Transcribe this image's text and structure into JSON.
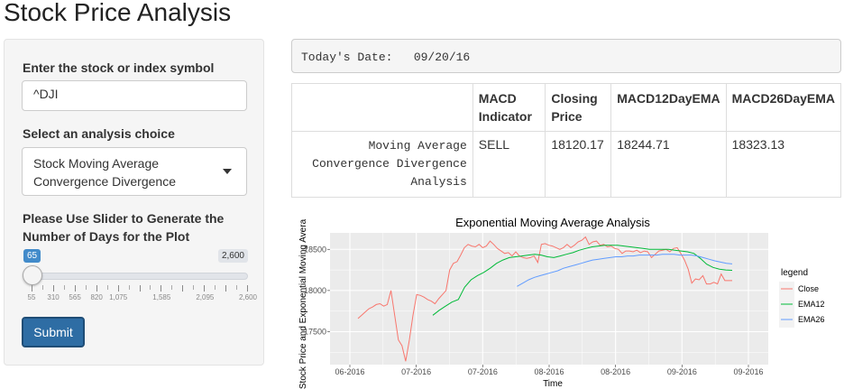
{
  "app": {
    "title": "Stock Price Analysis"
  },
  "sidebar": {
    "symbol_label": "Enter the stock or index symbol",
    "symbol_value": "^DJI",
    "analysis_label": "Select an analysis choice",
    "analysis_selected_line1": "Stock Moving Average",
    "analysis_selected_line2": "Convergence Divergence",
    "slider_label_line1": "Please Use Slider to Generate the",
    "slider_label_line2": "Number of Days for the Plot",
    "slider": {
      "min_badge": "65",
      "max_badge": "2,600",
      "value": 65,
      "min": 55,
      "max": 2600,
      "grid_labels": [
        "55",
        "310",
        "565",
        "820",
        "1,075",
        "1,585",
        "2,095",
        "2,600"
      ]
    },
    "submit_label": "Submit"
  },
  "main": {
    "date_label": "Today's Date:",
    "date_value": "09/20/16",
    "table": {
      "headers": [
        "",
        "MACD Indicator",
        "Closing Price",
        "MACD12DayEMA",
        "MACD26DayEMA"
      ],
      "row": {
        "name_line1": "Moving Average",
        "name_line2": "Convergence Divergence",
        "name_line3": "Analysis",
        "indicator": "SELL",
        "closing": "18120.17",
        "ema12": "18244.71",
        "ema26": "18323.13"
      }
    }
  },
  "chart_data": {
    "type": "line",
    "title": "Exponential Moving Average Analysis",
    "xlabel": "Time",
    "ylabel": "Stock Price and Exponential Moving Avera",
    "x_tick_labels": [
      "06-2016",
      "07-2016",
      "07-2016",
      "08-2016",
      "08-2016",
      "09-2016",
      "09-2016"
    ],
    "y_ticks": [
      17500,
      18000,
      18500
    ],
    "ylim": [
      17100,
      18700
    ],
    "grid": true,
    "legend_title": "legend",
    "legend_position": "right",
    "background": "#ebebeb",
    "series": [
      {
        "name": "Close",
        "color": "#f8766d",
        "values": [
          17660,
          17700,
          17740,
          17780,
          17800,
          17830,
          17840,
          17810,
          17830,
          18000,
          17700,
          17400,
          17330,
          17140,
          17400,
          17700,
          17950,
          17940,
          17920,
          17890,
          17870,
          17840,
          17900,
          17950,
          18000,
          18250,
          18330,
          18350,
          18430,
          18520,
          18560,
          18540,
          18530,
          18560,
          18520,
          18540,
          18600,
          18560,
          18510,
          18480,
          18450,
          18460,
          18420,
          18470,
          18420,
          18400,
          18390,
          18400,
          18420,
          18340,
          18560,
          18570,
          18550,
          18540,
          18520,
          18500,
          18520,
          18560,
          18520,
          18550,
          18590,
          18610,
          18650,
          18560,
          18590,
          18600,
          18550,
          18560,
          18530,
          18540,
          18510,
          18500,
          18450,
          18480,
          18480,
          18470,
          18490,
          18460,
          18480,
          18470,
          18400,
          18440,
          18480,
          18490,
          18500,
          18470,
          18510,
          18520,
          18450,
          18370,
          18260,
          18090,
          18140,
          18130,
          18180,
          18080,
          18080,
          18100,
          18080,
          18200,
          18120,
          18120,
          18120
        ]
      },
      {
        "name": "EMA12",
        "color": "#00ba38",
        "values": [
          17700,
          17760,
          17810,
          17860,
          17890,
          18040,
          18130,
          18180,
          18220,
          18270,
          18330,
          18370,
          18400,
          18410,
          18420,
          18430,
          18440,
          18430,
          18410,
          18400,
          18420,
          18440,
          18460,
          18490,
          18510,
          18530,
          18540,
          18550,
          18550,
          18550,
          18540,
          18530,
          18520,
          18510,
          18500,
          18500,
          18500,
          18500,
          18490,
          18480,
          18470,
          18450,
          18390,
          18320,
          18280,
          18260,
          18250,
          18245
        ]
      },
      {
        "name": "EMA26",
        "color": "#619cff",
        "values": [
          18050,
          18090,
          18130,
          18160,
          18180,
          18200,
          18220,
          18240,
          18270,
          18290,
          18310,
          18330,
          18350,
          18370,
          18380,
          18390,
          18400,
          18410,
          18410,
          18420,
          18420,
          18430,
          18430,
          18430,
          18430,
          18440,
          18440,
          18440,
          18430,
          18430,
          18430,
          18420,
          18400,
          18380,
          18360,
          18345,
          18330,
          18323
        ]
      }
    ]
  }
}
